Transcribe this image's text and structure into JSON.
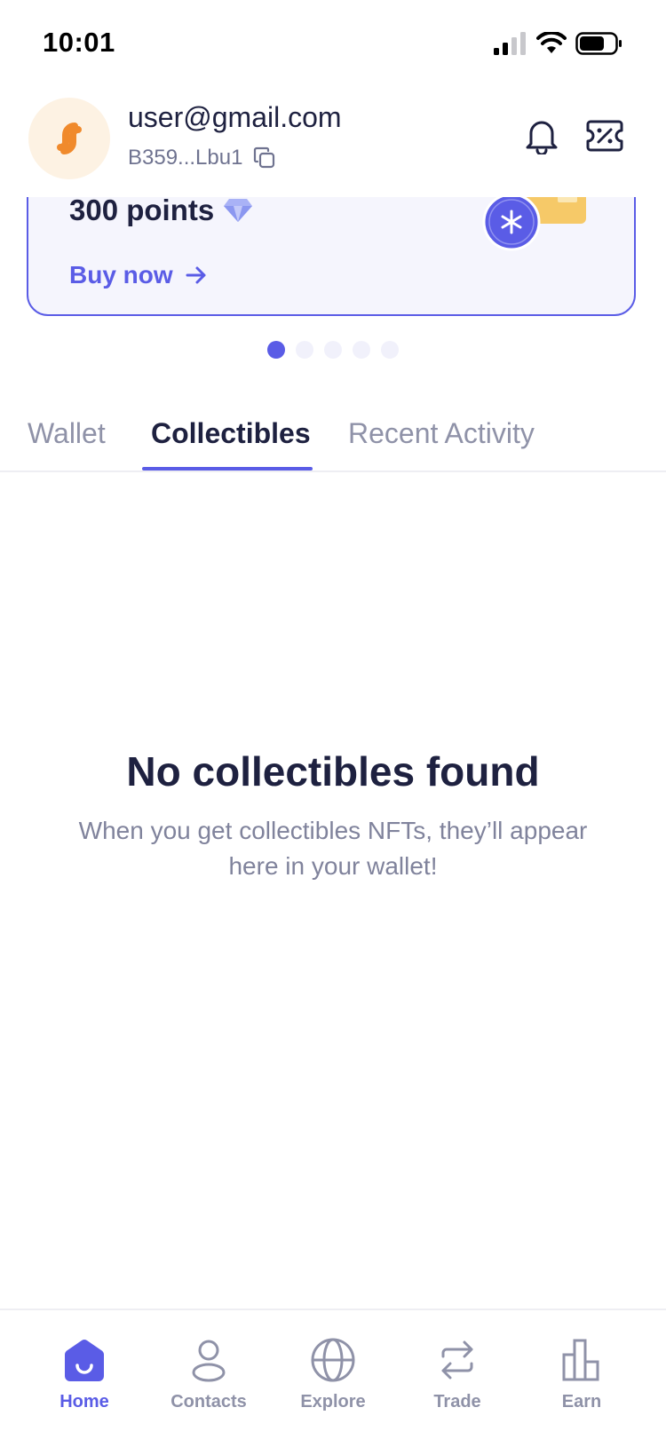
{
  "status_bar": {
    "time": "10:01"
  },
  "header": {
    "email": "user@gmail.com",
    "address": "B359...Lbu1"
  },
  "promo": {
    "title": "300 points",
    "cta": "Buy now"
  },
  "tabs": [
    {
      "label": "Wallet"
    },
    {
      "label": "Collectibles"
    },
    {
      "label": "Recent Activity"
    }
  ],
  "empty_state": {
    "title": "No collectibles found",
    "subtitle": "When you get collectibles NFTs, they’ll appear here in your wallet!"
  },
  "bottom_nav": [
    {
      "label": "Home",
      "icon": "home-icon"
    },
    {
      "label": "Contacts",
      "icon": "contacts-icon"
    },
    {
      "label": "Explore",
      "icon": "globe-icon"
    },
    {
      "label": "Trade",
      "icon": "swap-icon"
    },
    {
      "label": "Earn",
      "icon": "bar-chart-icon"
    }
  ],
  "colors": {
    "accent": "#5a5ce6",
    "text": "#1e2140",
    "muted": "#8f92a8",
    "avatar_bg": "#fdf2e3",
    "brand_orange": "#f08a2c"
  }
}
